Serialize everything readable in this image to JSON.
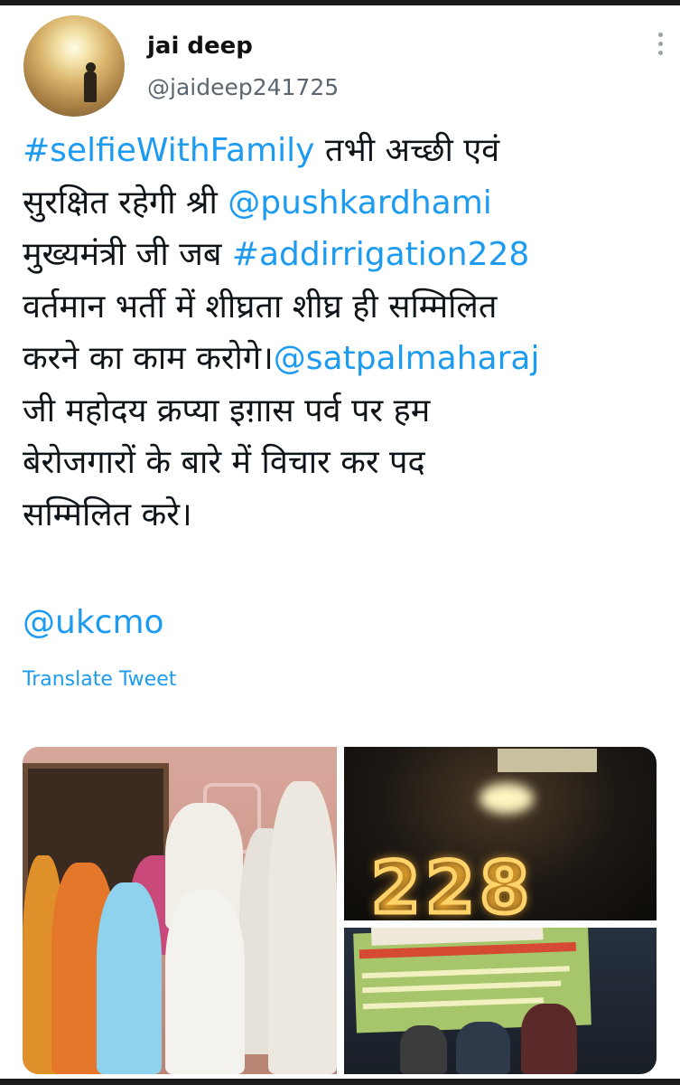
{
  "tweet": {
    "author": {
      "name": "jai deep",
      "handle": "@jaideep241725"
    },
    "text_lines": [
      [
        {
          "text": "#selfieWithFamily",
          "link": true
        },
        {
          "text": " तभी अच्छी एवं",
          "link": false
        }
      ],
      [
        {
          "text": "सुरक्षित रहेगी श्री ",
          "link": false
        },
        {
          "text": "@pushkardhami",
          "link": true
        }
      ],
      [
        {
          "text": "मुख्यमंत्री जी जब ",
          "link": false
        },
        {
          "text": "#addirrigation228",
          "link": true
        }
      ],
      [
        {
          "text": "वर्तमान भर्ती में शीघ्रता शीघ्र ही सम्मिलित",
          "link": false
        }
      ],
      [
        {
          "text": "करने का काम करोगे।",
          "link": false
        },
        {
          "text": "@satpalmaharaj",
          "link": true
        }
      ],
      [
        {
          "text": "जी महोदय क्रप्या इग़ास पर्व पर हम",
          "link": false
        }
      ],
      [
        {
          "text": "बेरोजगारों के बारे में विचार कर पद",
          "link": false
        }
      ],
      [
        {
          "text": "सम्मिलित करे।",
          "link": false
        }
      ]
    ],
    "mention": "@ukcmo",
    "translate_label": "Translate Tweet",
    "more_icon": "more-vertical-icon"
  },
  "colors": {
    "link": "#1d9bf0",
    "text": "#0f1419",
    "secondary": "#5b6670"
  }
}
